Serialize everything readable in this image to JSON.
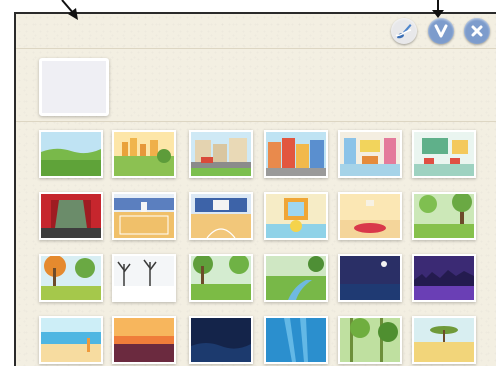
{
  "toolbar": {
    "paint_icon": "paintbrush-icon",
    "ok_icon": "checkmark-icon",
    "close_icon": "close-x-icon"
  },
  "colors": {
    "panel_background": "#f3efe2",
    "button_blue": "#7d9ccc",
    "frame_border": "#2a2a2a"
  },
  "preview": {
    "selected": "blank"
  },
  "backgrounds": [
    "grass-field",
    "park-city",
    "street",
    "city-buildings",
    "classroom",
    "school-room",
    "theater-stage",
    "gym",
    "basketball-court",
    "bedroom-window",
    "room-rug",
    "forest",
    "autumn-park",
    "winter-trees",
    "green-park",
    "river-valley",
    "night-lake",
    "purple-night",
    "beach",
    "sunset",
    "night-ocean",
    "underwater",
    "jungle",
    "savanna"
  ]
}
